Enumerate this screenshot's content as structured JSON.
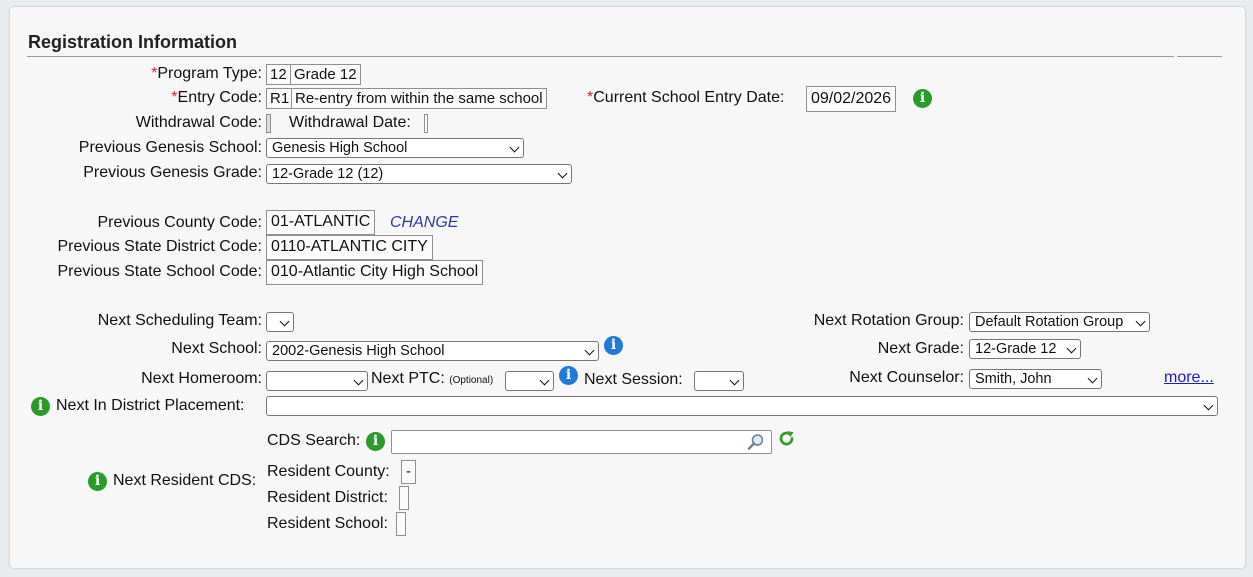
{
  "section": {
    "title": "Registration Information"
  },
  "program_type": {
    "label": "Program Type:",
    "code": "12",
    "value": "Grade 12"
  },
  "entry_code": {
    "label": "Entry Code:",
    "code": "R1",
    "value": "Re-entry from within the same school"
  },
  "current_school_entry_date": {
    "label": "Current School Entry Date:",
    "value": "09/02/2026"
  },
  "withdrawal_code": {
    "label": "Withdrawal Code:",
    "value": ""
  },
  "withdrawal_date": {
    "label": "Withdrawal Date:",
    "value": ""
  },
  "previous_genesis_school": {
    "label": "Previous Genesis School:",
    "value": "Genesis High School"
  },
  "previous_genesis_grade": {
    "label": "Previous Genesis Grade:",
    "value": "12-Grade 12 (12)"
  },
  "previous_county_code": {
    "label": "Previous County Code:",
    "value": "01-ATLANTIC",
    "change_link": "CHANGE"
  },
  "previous_state_district_code": {
    "label": "Previous State District Code:",
    "value": "0110-ATLANTIC CITY"
  },
  "previous_state_school_code": {
    "label": "Previous State School Code:",
    "value": "010-Atlantic City High School"
  },
  "next_scheduling_team": {
    "label": "Next Scheduling Team:",
    "value": ""
  },
  "next_rotation_group": {
    "label": "Next Rotation Group:",
    "value": "Default Rotation Group"
  },
  "next_school": {
    "label": "Next School:",
    "value": "2002-Genesis High School"
  },
  "next_grade": {
    "label": "Next Grade:",
    "value": "12-Grade 12"
  },
  "next_homeroom": {
    "label": "Next Homeroom:",
    "value": ""
  },
  "next_ptc": {
    "label": "Next PTC:",
    "optional": "(Optional)",
    "value": ""
  },
  "next_session": {
    "label": "Next Session:",
    "value": ""
  },
  "next_counselor": {
    "label": "Next Counselor:",
    "value": "Smith, John"
  },
  "more_link": "more...",
  "next_in_district_placement": {
    "label": "Next In District Placement:",
    "value": ""
  },
  "cds_search": {
    "label": "CDS Search:",
    "value": ""
  },
  "next_resident_cds": {
    "label": "Next Resident CDS:"
  },
  "resident_county": {
    "label": "Resident County:",
    "value": "-"
  },
  "resident_district": {
    "label": "Resident District:",
    "value": ""
  },
  "resident_school": {
    "label": "Resident School:",
    "value": ""
  },
  "icons": {
    "info_green": "i",
    "info_blue": "i",
    "required_mark": "*"
  },
  "colors": {
    "required": "#c0302b",
    "info_green": "#2b9a2b",
    "info_blue": "#1f7ad8",
    "link": "#2a3aa6"
  }
}
